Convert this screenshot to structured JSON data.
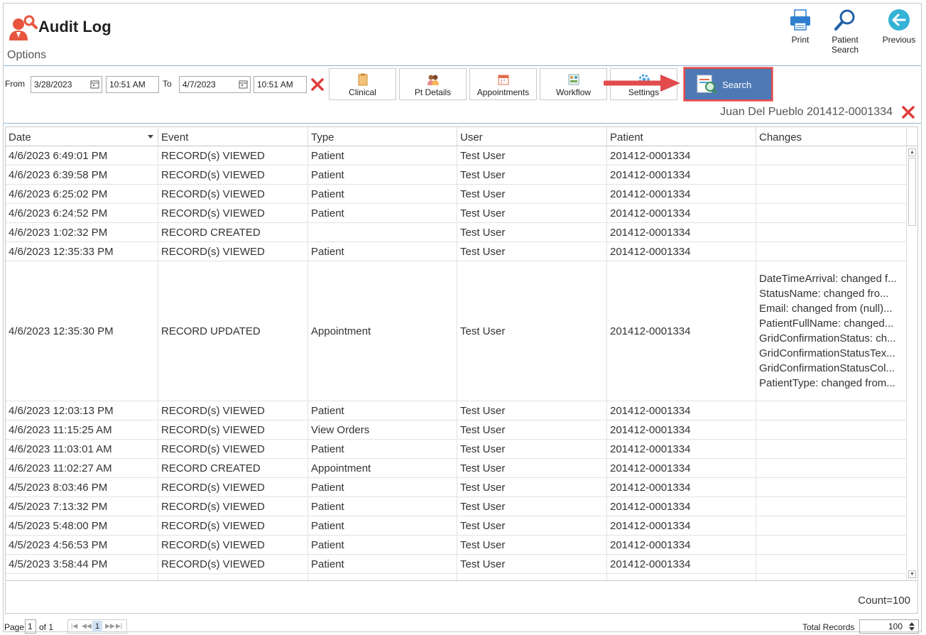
{
  "header": {
    "title": "Audit Log",
    "options_label": "Options",
    "buttons": [
      {
        "label": "Print",
        "icon": "printer-icon"
      },
      {
        "label": "Patient Search",
        "icon": "magnifier-icon"
      },
      {
        "label": "Previous",
        "icon": "back-arrow-icon"
      }
    ]
  },
  "filter": {
    "from_label": "From",
    "from_date": "3/28/2023",
    "from_time": "10:51 AM",
    "to_label": "To",
    "to_date": "4/7/2023",
    "to_time": "10:51 AM"
  },
  "toolbar": {
    "buttons": [
      {
        "label": "Clinical",
        "icon": "clipboard-icon"
      },
      {
        "label": "Pt Details",
        "icon": "people-icon"
      },
      {
        "label": "Appointments",
        "icon": "calendar-icon"
      },
      {
        "label": "Workflow",
        "icon": "workflow-icon"
      },
      {
        "label": "Settings",
        "icon": "gear-icon"
      }
    ],
    "search_label": "Search"
  },
  "selected_patient": "Juan Del Pueblo 201412-0001334",
  "grid": {
    "columns": [
      "Date",
      "Event",
      "Type",
      "User",
      "Patient",
      "Changes"
    ],
    "rows": [
      {
        "date": "4/6/2023 6:49:01 PM",
        "event": "RECORD(s) VIEWED",
        "type": "Patient",
        "user": "Test User",
        "patient": "201412-0001334",
        "changes": []
      },
      {
        "date": "4/6/2023 6:39:58 PM",
        "event": "RECORD(s) VIEWED",
        "type": "Patient",
        "user": "Test User",
        "patient": "201412-0001334",
        "changes": []
      },
      {
        "date": "4/6/2023 6:25:02 PM",
        "event": "RECORD(s) VIEWED",
        "type": "Patient",
        "user": "Test User",
        "patient": "201412-0001334",
        "changes": []
      },
      {
        "date": "4/6/2023 6:24:52 PM",
        "event": "RECORD(s) VIEWED",
        "type": "Patient",
        "user": "Test User",
        "patient": "201412-0001334",
        "changes": []
      },
      {
        "date": "4/6/2023 1:02:32 PM",
        "event": "RECORD CREATED",
        "type": "",
        "user": "Test User",
        "patient": "201412-0001334",
        "changes": []
      },
      {
        "date": "4/6/2023 12:35:33 PM",
        "event": "RECORD(s) VIEWED",
        "type": "Patient",
        "user": "Test User",
        "patient": "201412-0001334",
        "changes": []
      },
      {
        "date": "4/6/2023 12:35:30 PM",
        "event": "RECORD UPDATED",
        "type": "Appointment",
        "user": "Test User",
        "patient": "201412-0001334",
        "changes": [
          "DateTimeArrival: changed f...",
          "StatusName: changed fro...",
          "Email: changed from (null)...",
          "PatientFullName: changed...",
          "GridConfirmationStatus: ch...",
          "GridConfirmationStatusTex...",
          "GridConfirmationStatusCol...",
          "PatientType: changed from..."
        ]
      },
      {
        "date": "4/6/2023 12:03:13 PM",
        "event": "RECORD(s) VIEWED",
        "type": "Patient",
        "user": "Test User",
        "patient": "201412-0001334",
        "changes": []
      },
      {
        "date": "4/6/2023 11:15:25 AM",
        "event": "RECORD(s) VIEWED",
        "type": "View Orders",
        "user": "Test User",
        "patient": "201412-0001334",
        "changes": []
      },
      {
        "date": "4/6/2023 11:03:01 AM",
        "event": "RECORD(s) VIEWED",
        "type": "Patient",
        "user": "Test User",
        "patient": "201412-0001334",
        "changes": []
      },
      {
        "date": "4/6/2023 11:02:27 AM",
        "event": "RECORD CREATED",
        "type": "Appointment",
        "user": "Test User",
        "patient": "201412-0001334",
        "changes": []
      },
      {
        "date": "4/5/2023 8:03:46 PM",
        "event": "RECORD(s) VIEWED",
        "type": "Patient",
        "user": "Test User",
        "patient": "201412-0001334",
        "changes": []
      },
      {
        "date": "4/5/2023 7:13:32 PM",
        "event": "RECORD(s) VIEWED",
        "type": "Patient",
        "user": "Test User",
        "patient": "201412-0001334",
        "changes": []
      },
      {
        "date": "4/5/2023 5:48:00 PM",
        "event": "RECORD(s) VIEWED",
        "type": "Patient",
        "user": "Test User",
        "patient": "201412-0001334",
        "changes": []
      },
      {
        "date": "4/5/2023 4:56:53 PM",
        "event": "RECORD(s) VIEWED",
        "type": "Patient",
        "user": "Test User",
        "patient": "201412-0001334",
        "changes": []
      },
      {
        "date": "4/5/2023 3:58:44 PM",
        "event": "RECORD(s) VIEWED",
        "type": "Patient",
        "user": "Test User",
        "patient": "201412-0001334",
        "changes": []
      }
    ],
    "count_text": "Count=100"
  },
  "pager": {
    "page_label": "Page",
    "page_value": "1",
    "of_label": "of 1",
    "current_page": "1",
    "total_label": "Total Records",
    "total_value": "100"
  },
  "colors": {
    "accent": "#4e79b5",
    "highlight_border": "#e14b4b",
    "clear_x": "#e03c3c",
    "logo": "#e8553e",
    "rule": "#8ab4d8"
  }
}
